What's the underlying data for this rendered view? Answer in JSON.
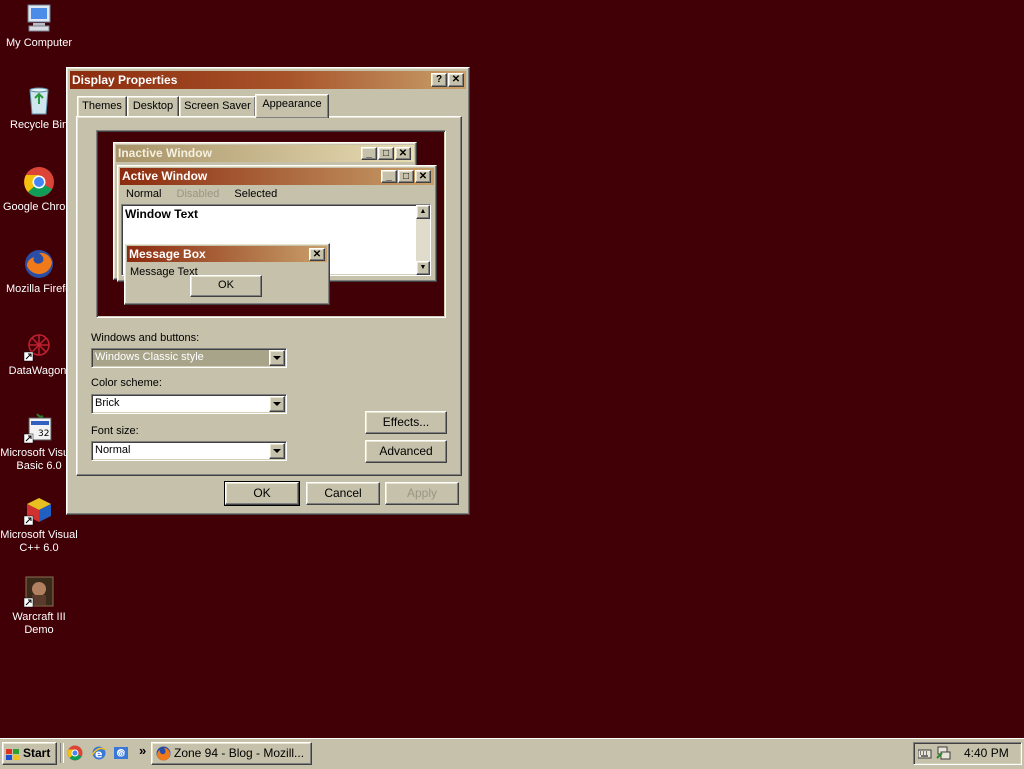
{
  "desktop_icons": [
    {
      "label": "My Computer",
      "icon": "my-computer-icon"
    },
    {
      "label": "Recycle Bin",
      "icon": "recycle-bin-icon"
    },
    {
      "label": "Google Chrome",
      "icon": "chrome-icon"
    },
    {
      "label": "Mozilla Firefox",
      "icon": "firefox-icon"
    },
    {
      "label": "DataWagon.",
      "icon": "datawagon-icon"
    },
    {
      "label": "Microsoft Visual Basic 6.0",
      "icon": "visual-basic-icon"
    },
    {
      "label": "Microsoft Visual C++ 6.0",
      "icon": "visual-cpp-icon"
    },
    {
      "label": "Warcraft III Demo",
      "icon": "warcraft-icon"
    }
  ],
  "dialog": {
    "title": "Display Properties",
    "help_glyph": "?",
    "close_glyph": "✕",
    "tabs": [
      "Themes",
      "Desktop",
      "Screen Saver",
      "Appearance"
    ],
    "active_tab": "Appearance",
    "preview": {
      "inactive_title": "Inactive Window",
      "active_title": "Active Window",
      "menu": [
        "Normal",
        "Disabled",
        "Selected"
      ],
      "window_text": "Window Text",
      "msgbox_title": "Message Box",
      "msgbox_text": "Message Text",
      "msgbox_ok": "OK"
    },
    "windows_buttons_label": "Windows and buttons:",
    "windows_buttons_value": "Windows Classic style",
    "color_scheme_label": "Color scheme:",
    "color_scheme_value": "Brick",
    "font_size_label": "Font size:",
    "font_size_value": "Normal",
    "effects_label": "Effects...",
    "advanced_label": "Advanced",
    "ok_label": "OK",
    "cancel_label": "Cancel",
    "apply_label": "Apply"
  },
  "taskbar": {
    "start_label": "Start",
    "quicklaunch_more": "»",
    "window_button": "Zone 94 - Blog - Mozill...",
    "clock": "4:40 PM"
  },
  "colors": {
    "desktop": "#400006",
    "face": "#c5c1aa",
    "active_title_start": "#8c2a0e",
    "active_title_end": "#c8a06a",
    "inactive_title_start": "#a89368",
    "inactive_title_end": "#e8dcb4"
  }
}
